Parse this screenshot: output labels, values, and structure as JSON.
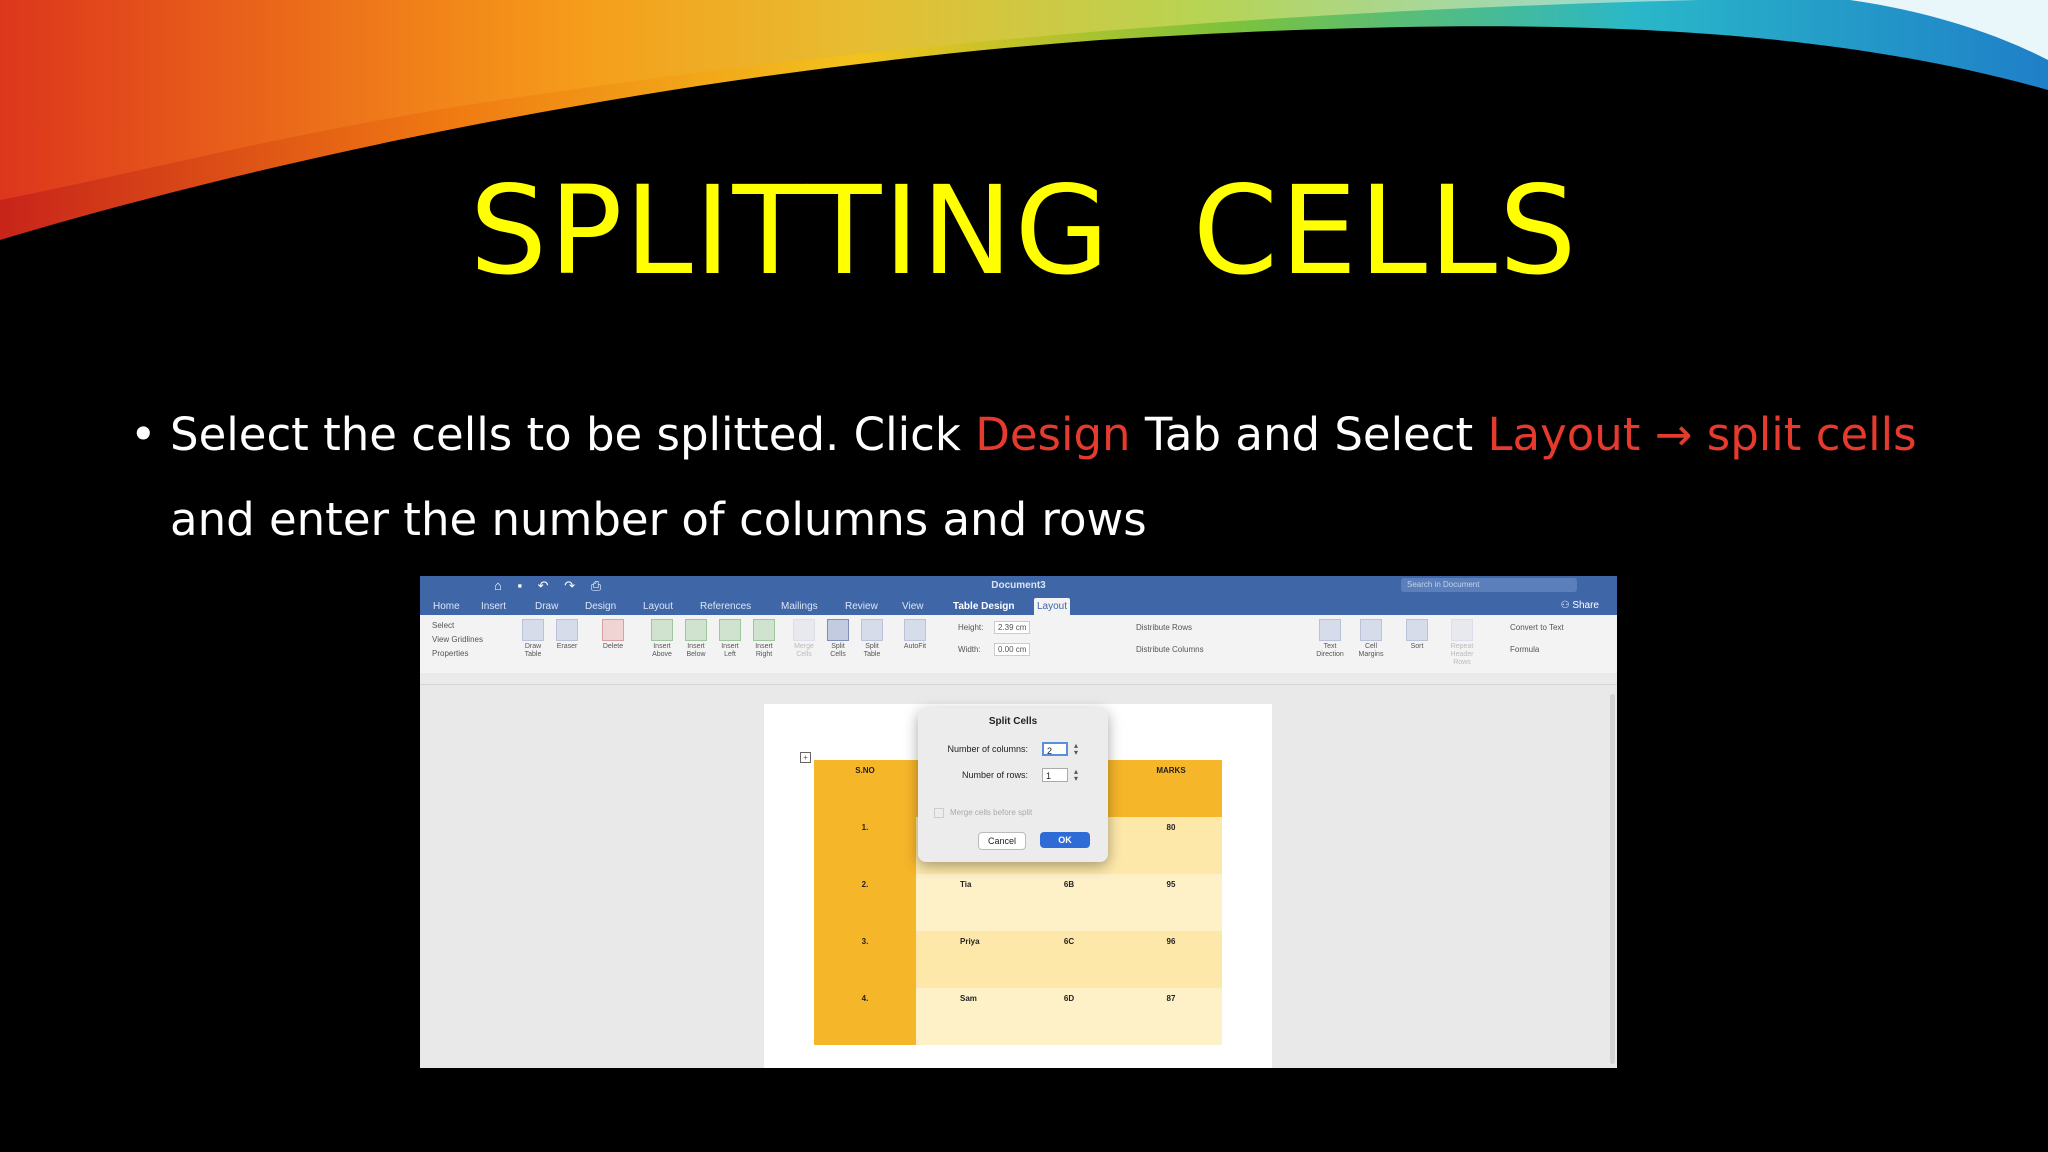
{
  "slide": {
    "title": "SPLITTING  CELLS",
    "bullet": {
      "symbol": "•",
      "parts": [
        {
          "text": "Select the cells to be splitted. Click ",
          "style": "plain"
        },
        {
          "text": "Design",
          "style": "red"
        },
        {
          "text": " Tab and Select ",
          "style": "plain"
        },
        {
          "text": "Layout",
          "style": "red"
        },
        {
          "text": " → ",
          "style": "red"
        },
        {
          "text": "split cells",
          "style": "red"
        },
        {
          "text": " and enter the number of columns and rows",
          "style": "plain"
        }
      ]
    },
    "colors": {
      "title": "#ffff00",
      "highlight": "#e53a2e",
      "body": "#ffffff",
      "background": "#000000"
    }
  },
  "screenshot": {
    "window_title": "Document3",
    "search_placeholder": "Search in Document",
    "share_label": "Share",
    "tabs": [
      "Home",
      "Insert",
      "Draw",
      "Design",
      "Layout",
      "References",
      "Mailings",
      "Review",
      "View",
      "Table Design",
      "Layout"
    ],
    "ribbon": {
      "select": "Select",
      "view_gridlines": "View Gridlines",
      "properties": "Properties",
      "draw_table": "Draw Table",
      "eraser": "Eraser",
      "delete": "Delete",
      "insert_above": "Insert Above",
      "insert_below": "Insert Below",
      "insert_left": "Insert Left",
      "insert_right": "Insert Right",
      "merge_cells": "Merge Cells",
      "split_cells": "Split Cells",
      "split_table": "Split Table",
      "autofit": "AutoFit",
      "height_label": "Height:",
      "height_value": "2.39 cm",
      "width_label": "Width:",
      "width_value": "0.00 cm",
      "distribute_rows": "Distribute Rows",
      "distribute_columns": "Distribute Columns",
      "text_direction": "Text Direction",
      "cell_margins": "Cell Margins",
      "sort": "Sort",
      "repeat_header_rows": "Repeat Header Rows",
      "convert_to_text": "Convert to Text",
      "formula": "Formula"
    },
    "table": {
      "headers": [
        "S.NO",
        "",
        "",
        "MARKS"
      ],
      "rows": [
        [
          "1.",
          "",
          "",
          "80"
        ],
        [
          "2.",
          "Tia",
          "6B",
          "95"
        ],
        [
          "3.",
          "Priya",
          "6C",
          "96"
        ],
        [
          "4.",
          "Sam",
          "6D",
          "87"
        ]
      ]
    },
    "dialog": {
      "title": "Split Cells",
      "columns_label": "Number of columns:",
      "columns_value": "2",
      "rows_label": "Number of rows:",
      "rows_value": "1",
      "merge_label": "Merge cells before split",
      "cancel_label": "Cancel",
      "ok_label": "OK"
    }
  }
}
